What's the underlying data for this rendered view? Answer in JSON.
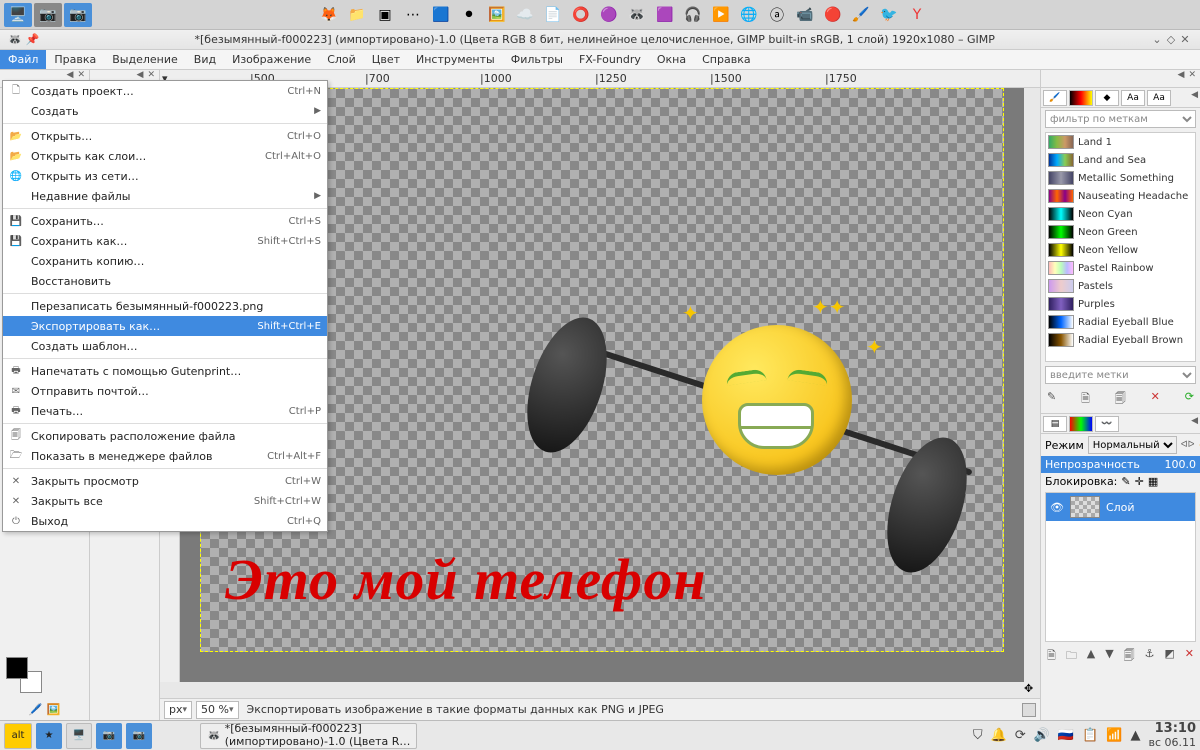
{
  "window": {
    "title": "*[безымянный-f000223] (импортировано)-1.0 (Цвета RGB 8 бит, нелинейное целочисленное, GIMP built-in sRGB, 1 слой) 1920x1080 – GIMP"
  },
  "menubar": [
    "Файл",
    "Правка",
    "Выделение",
    "Вид",
    "Изображение",
    "Слой",
    "Цвет",
    "Инструменты",
    "Фильтры",
    "FX-Foundry",
    "Окна",
    "Справка"
  ],
  "file_menu": [
    {
      "type": "item",
      "icon": "new",
      "label": "Создать проект…",
      "shortcut": "Ctrl+N"
    },
    {
      "type": "item",
      "icon": "",
      "label": "Создать",
      "arrow": true
    },
    {
      "type": "sep"
    },
    {
      "type": "item",
      "icon": "open",
      "label": "Открыть…",
      "shortcut": "Ctrl+O"
    },
    {
      "type": "item",
      "icon": "open",
      "label": "Открыть как слои…",
      "shortcut": "Ctrl+Alt+O"
    },
    {
      "type": "item",
      "icon": "globe",
      "label": "Открыть из сети…"
    },
    {
      "type": "item",
      "icon": "",
      "label": "Недавние файлы",
      "arrow": true
    },
    {
      "type": "sep"
    },
    {
      "type": "item",
      "icon": "save",
      "label": "Сохранить…",
      "shortcut": "Ctrl+S"
    },
    {
      "type": "item",
      "icon": "saveas",
      "label": "Сохранить как…",
      "shortcut": "Shift+Ctrl+S"
    },
    {
      "type": "item",
      "icon": "",
      "label": "Сохранить копию…"
    },
    {
      "type": "item",
      "icon": "",
      "label": "Восстановить"
    },
    {
      "type": "sep"
    },
    {
      "type": "item",
      "icon": "",
      "label": "Перезаписать безымянный-f000223.png"
    },
    {
      "type": "item",
      "icon": "",
      "label": "Экспортировать как…",
      "shortcut": "Shift+Ctrl+E",
      "selected": true
    },
    {
      "type": "item",
      "icon": "",
      "label": "Создать шаблон…"
    },
    {
      "type": "sep"
    },
    {
      "type": "item",
      "icon": "print",
      "label": "Напечатать с помощью Gutenprint…"
    },
    {
      "type": "item",
      "icon": "mail",
      "label": "Отправить почтой…"
    },
    {
      "type": "item",
      "icon": "print",
      "label": "Печать…",
      "shortcut": "Ctrl+P"
    },
    {
      "type": "sep"
    },
    {
      "type": "item",
      "icon": "copy",
      "label": "Скопировать расположение файла"
    },
    {
      "type": "item",
      "icon": "fm",
      "label": "Показать в менеджере файлов",
      "shortcut": "Ctrl+Alt+F"
    },
    {
      "type": "sep"
    },
    {
      "type": "item",
      "icon": "x",
      "label": "Закрыть просмотр",
      "shortcut": "Ctrl+W"
    },
    {
      "type": "item",
      "icon": "x",
      "label": "Закрыть все",
      "shortcut": "Shift+Ctrl+W"
    },
    {
      "type": "item",
      "icon": "exit",
      "label": "Выход",
      "shortcut": "Ctrl+Q"
    }
  ],
  "ruler_ticks": [
    "|500",
    "|700",
    "|1000",
    "|1250",
    "|1500",
    "|1750"
  ],
  "canvas": {
    "text": "Это мой  телефон"
  },
  "status": {
    "unit": "px",
    "zoom": "50 %",
    "hint": "Экспортировать изображение в такие форматы данных как PNG и JPEG"
  },
  "gradients_filter_placeholder": "фильтр по меткам",
  "gradients": [
    {
      "name": "Land 1",
      "css": "linear-gradient(90deg,#3a6,#8b4,#c96,#865)"
    },
    {
      "name": "Land and Sea",
      "css": "linear-gradient(90deg,#039,#0af,#8c5,#863)"
    },
    {
      "name": "Metallic Something",
      "css": "linear-gradient(90deg,#446,#99a,#446)"
    },
    {
      "name": "Nauseating Headache",
      "css": "linear-gradient(90deg,#808,#f60,#808,#f60)"
    },
    {
      "name": "Neon Cyan",
      "css": "linear-gradient(90deg,#000,#0ff,#000)"
    },
    {
      "name": "Neon Green",
      "css": "linear-gradient(90deg,#000,#0f0,#000)"
    },
    {
      "name": "Neon Yellow",
      "css": "linear-gradient(90deg,#000,#ff0,#000)"
    },
    {
      "name": "Pastel Rainbow",
      "css": "linear-gradient(90deg,#fbb,#ffb,#bfb,#bbf,#fbf)"
    },
    {
      "name": "Pastels",
      "css": "linear-gradient(90deg,#c9e,#ecc,#cce)"
    },
    {
      "name": "Purples",
      "css": "linear-gradient(90deg,#302060,#8060c0,#302060)"
    },
    {
      "name": "Radial Eyeball Blue",
      "css": "linear-gradient(90deg,#000,#06f,#fff)"
    },
    {
      "name": "Radial Eyeball Brown",
      "css": "linear-gradient(90deg,#000,#850,#fff)"
    }
  ],
  "tags_placeholder": "введите метки",
  "layers": {
    "mode_label": "Режим",
    "mode_value": "Нормальный",
    "opacity_label": "Непрозрачность",
    "opacity_value": "100.0",
    "lock_label": "Блокировка:",
    "layer_name": "Слой"
  },
  "bottom_app": {
    "title1": "*[безымянный-f000223]",
    "title2": "(импортировано)-1.0 (Цвета R…"
  },
  "clock": {
    "time": "13:10",
    "date": "вс 06.11"
  }
}
